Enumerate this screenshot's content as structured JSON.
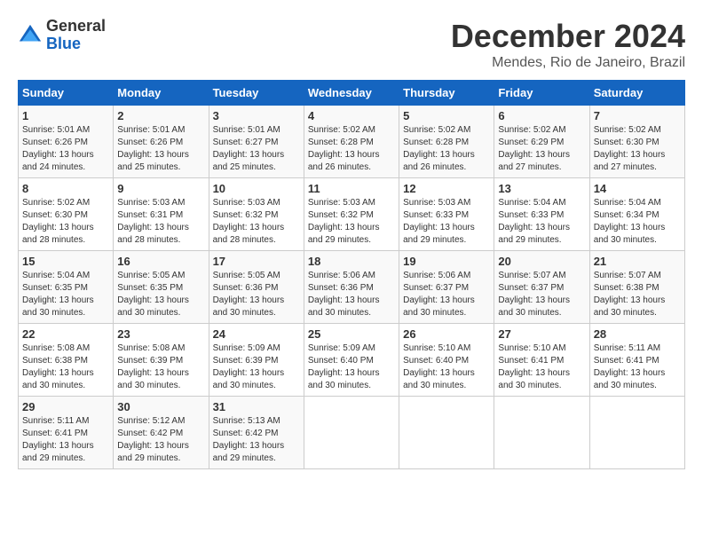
{
  "logo": {
    "general": "General",
    "blue": "Blue"
  },
  "title": "December 2024",
  "subtitle": "Mendes, Rio de Janeiro, Brazil",
  "days_of_week": [
    "Sunday",
    "Monday",
    "Tuesday",
    "Wednesday",
    "Thursday",
    "Friday",
    "Saturday"
  ],
  "weeks": [
    [
      {
        "day": "1",
        "sunrise": "5:01 AM",
        "sunset": "6:26 PM",
        "daylight": "13 hours and 24 minutes."
      },
      {
        "day": "2",
        "sunrise": "5:01 AM",
        "sunset": "6:26 PM",
        "daylight": "13 hours and 25 minutes."
      },
      {
        "day": "3",
        "sunrise": "5:01 AM",
        "sunset": "6:27 PM",
        "daylight": "13 hours and 25 minutes."
      },
      {
        "day": "4",
        "sunrise": "5:02 AM",
        "sunset": "6:28 PM",
        "daylight": "13 hours and 26 minutes."
      },
      {
        "day": "5",
        "sunrise": "5:02 AM",
        "sunset": "6:28 PM",
        "daylight": "13 hours and 26 minutes."
      },
      {
        "day": "6",
        "sunrise": "5:02 AM",
        "sunset": "6:29 PM",
        "daylight": "13 hours and 27 minutes."
      },
      {
        "day": "7",
        "sunrise": "5:02 AM",
        "sunset": "6:30 PM",
        "daylight": "13 hours and 27 minutes."
      }
    ],
    [
      {
        "day": "8",
        "sunrise": "5:02 AM",
        "sunset": "6:30 PM",
        "daylight": "13 hours and 28 minutes."
      },
      {
        "day": "9",
        "sunrise": "5:03 AM",
        "sunset": "6:31 PM",
        "daylight": "13 hours and 28 minutes."
      },
      {
        "day": "10",
        "sunrise": "5:03 AM",
        "sunset": "6:32 PM",
        "daylight": "13 hours and 28 minutes."
      },
      {
        "day": "11",
        "sunrise": "5:03 AM",
        "sunset": "6:32 PM",
        "daylight": "13 hours and 29 minutes."
      },
      {
        "day": "12",
        "sunrise": "5:03 AM",
        "sunset": "6:33 PM",
        "daylight": "13 hours and 29 minutes."
      },
      {
        "day": "13",
        "sunrise": "5:04 AM",
        "sunset": "6:33 PM",
        "daylight": "13 hours and 29 minutes."
      },
      {
        "day": "14",
        "sunrise": "5:04 AM",
        "sunset": "6:34 PM",
        "daylight": "13 hours and 30 minutes."
      }
    ],
    [
      {
        "day": "15",
        "sunrise": "5:04 AM",
        "sunset": "6:35 PM",
        "daylight": "13 hours and 30 minutes."
      },
      {
        "day": "16",
        "sunrise": "5:05 AM",
        "sunset": "6:35 PM",
        "daylight": "13 hours and 30 minutes."
      },
      {
        "day": "17",
        "sunrise": "5:05 AM",
        "sunset": "6:36 PM",
        "daylight": "13 hours and 30 minutes."
      },
      {
        "day": "18",
        "sunrise": "5:06 AM",
        "sunset": "6:36 PM",
        "daylight": "13 hours and 30 minutes."
      },
      {
        "day": "19",
        "sunrise": "5:06 AM",
        "sunset": "6:37 PM",
        "daylight": "13 hours and 30 minutes."
      },
      {
        "day": "20",
        "sunrise": "5:07 AM",
        "sunset": "6:37 PM",
        "daylight": "13 hours and 30 minutes."
      },
      {
        "day": "21",
        "sunrise": "5:07 AM",
        "sunset": "6:38 PM",
        "daylight": "13 hours and 30 minutes."
      }
    ],
    [
      {
        "day": "22",
        "sunrise": "5:08 AM",
        "sunset": "6:38 PM",
        "daylight": "13 hours and 30 minutes."
      },
      {
        "day": "23",
        "sunrise": "5:08 AM",
        "sunset": "6:39 PM",
        "daylight": "13 hours and 30 minutes."
      },
      {
        "day": "24",
        "sunrise": "5:09 AM",
        "sunset": "6:39 PM",
        "daylight": "13 hours and 30 minutes."
      },
      {
        "day": "25",
        "sunrise": "5:09 AM",
        "sunset": "6:40 PM",
        "daylight": "13 hours and 30 minutes."
      },
      {
        "day": "26",
        "sunrise": "5:10 AM",
        "sunset": "6:40 PM",
        "daylight": "13 hours and 30 minutes."
      },
      {
        "day": "27",
        "sunrise": "5:10 AM",
        "sunset": "6:41 PM",
        "daylight": "13 hours and 30 minutes."
      },
      {
        "day": "28",
        "sunrise": "5:11 AM",
        "sunset": "6:41 PM",
        "daylight": "13 hours and 30 minutes."
      }
    ],
    [
      {
        "day": "29",
        "sunrise": "5:11 AM",
        "sunset": "6:41 PM",
        "daylight": "13 hours and 29 minutes."
      },
      {
        "day": "30",
        "sunrise": "5:12 AM",
        "sunset": "6:42 PM",
        "daylight": "13 hours and 29 minutes."
      },
      {
        "day": "31",
        "sunrise": "5:13 AM",
        "sunset": "6:42 PM",
        "daylight": "13 hours and 29 minutes."
      },
      null,
      null,
      null,
      null
    ]
  ]
}
